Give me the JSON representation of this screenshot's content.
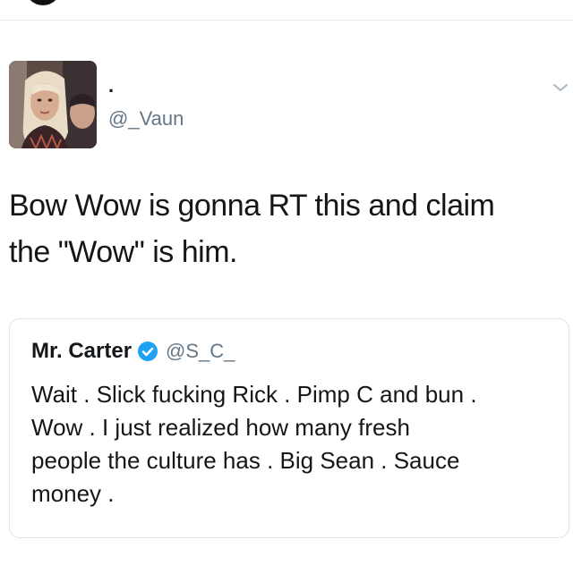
{
  "tweet": {
    "author": {
      "display_name": ".",
      "handle": "@_Vaun",
      "avatar_icon": "profile-photo"
    },
    "menu_icon": "chevron-down-icon",
    "text_line_1": "Bow Wow is gonna RT this and claim",
    "text_line_2": "the \"Wow\" is him."
  },
  "quoted_tweet": {
    "display_name": "Mr. Carter",
    "verified_icon": "verified-badge-icon",
    "handle": "@S_C_",
    "text_line_1": "Wait . Slick fucking Rick . Pimp C and bun .",
    "text_line_2": "Wow . I just realized how many fresh",
    "text_line_3": "people the culture has . Big Sean . Sauce",
    "text_line_4": "money ."
  },
  "colors": {
    "text_primary": "#14171a",
    "text_secondary": "#657786",
    "verified_blue": "#1da1f2",
    "border": "#dfe5ea"
  }
}
